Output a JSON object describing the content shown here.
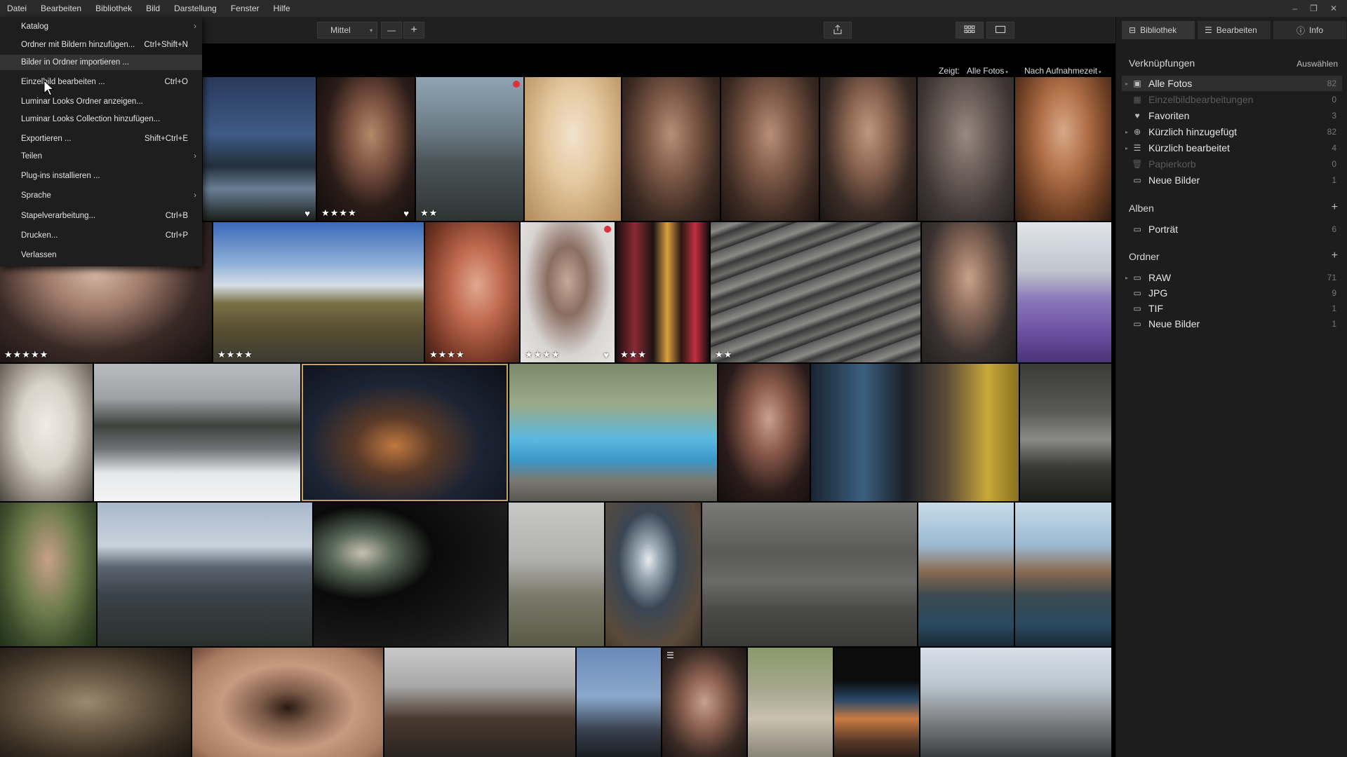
{
  "menubar": {
    "items": [
      "Datei",
      "Bearbeiten",
      "Bibliothek",
      "Bild",
      "Darstellung",
      "Fenster",
      "Hilfe"
    ],
    "window_controls": [
      "–",
      "❐",
      "✕"
    ]
  },
  "toolbar": {
    "zoom_select": "Mittel",
    "zoom_out": "—",
    "zoom_in": "+",
    "share_icon": "share-icon",
    "grid_icon": "grid-view-icon",
    "single_icon": "single-view-icon"
  },
  "filter": {
    "show_label": "Zeigt:",
    "show_value": "Alle Fotos",
    "sort_value": "Nach Aufnahmezeit"
  },
  "file_menu": {
    "items": [
      {
        "label": "Katalog",
        "shortcut": "",
        "submenu": true
      },
      {
        "label": "Ordner mit Bildern hinzufügen...",
        "shortcut": "Ctrl+Shift+N",
        "submenu": false
      },
      {
        "label": "Bilder in Ordner importieren ...",
        "shortcut": "",
        "submenu": false
      },
      {
        "label": "Einzelbild bearbeiten ...",
        "shortcut": "Ctrl+O",
        "submenu": false
      },
      {
        "label": "Luminar Looks Ordner anzeigen...",
        "shortcut": "",
        "submenu": false
      },
      {
        "label": "Luminar Looks Collection hinzufügen...",
        "shortcut": "",
        "submenu": false
      },
      {
        "label": "Exportieren ...",
        "shortcut": "Shift+Ctrl+E",
        "submenu": false
      },
      {
        "label": "Teilen",
        "shortcut": "",
        "submenu": true
      },
      {
        "label": "Plug-ins installieren ...",
        "shortcut": "",
        "submenu": false
      },
      {
        "label": "Sprache",
        "shortcut": "",
        "submenu": true
      },
      {
        "label": "Stapelverarbeitung...",
        "shortcut": "Ctrl+B",
        "submenu": false
      },
      {
        "label": "Drucken...",
        "shortcut": "Ctrl+P",
        "submenu": false
      },
      {
        "label": "Verlassen",
        "shortcut": "",
        "submenu": false
      }
    ]
  },
  "sidebar": {
    "tabs": [
      {
        "label": "Bibliothek",
        "icon": "library-icon"
      },
      {
        "label": "Bearbeiten",
        "icon": "sliders-icon"
      },
      {
        "label": "Info",
        "icon": "info-icon"
      }
    ],
    "shortcuts_title": "Verknüpfungen",
    "shortcuts_action": "Auswählen",
    "shortcuts": [
      {
        "label": "Alle Fotos",
        "count": "82"
      },
      {
        "label": "Einzelbildbearbeitungen",
        "count": "0"
      },
      {
        "label": "Favoriten",
        "count": "3"
      },
      {
        "label": "Kürzlich hinzugefügt",
        "count": "82"
      },
      {
        "label": "Kürzlich bearbeitet",
        "count": "4"
      },
      {
        "label": "Papierkorb",
        "count": "0"
      },
      {
        "label": "Neue Bilder",
        "count": "1"
      }
    ],
    "albums_title": "Alben",
    "albums_add": "+",
    "albums": [
      {
        "label": "Porträt",
        "count": "6"
      }
    ],
    "folders_title": "Ordner",
    "folders_add": "+",
    "folders": [
      {
        "label": "RAW",
        "count": "71"
      },
      {
        "label": "JPG",
        "count": "9"
      },
      {
        "label": "TIF",
        "count": "1"
      },
      {
        "label": "Neue Bilder",
        "count": "1"
      }
    ]
  },
  "photos": {
    "row1": [
      {
        "stars": "",
        "heart": "♥"
      },
      {
        "stars": "★★★★",
        "heart": "♥"
      },
      {
        "stars": "★★",
        "heart": ""
      },
      {
        "stars": "",
        "heart": ""
      },
      {
        "stars": "",
        "heart": ""
      },
      {
        "stars": "",
        "heart": ""
      },
      {
        "stars": "",
        "heart": ""
      },
      {
        "stars": "",
        "heart": ""
      },
      {
        "stars": "",
        "heart": ""
      }
    ],
    "row2": [
      {
        "stars": "★★★★★",
        "heart": ""
      },
      {
        "stars": "★★★★",
        "heart": ""
      },
      {
        "stars": "★★★★",
        "heart": ""
      },
      {
        "stars": "★★★★",
        "heart": "♥"
      },
      {
        "stars": "★★★",
        "heart": ""
      },
      {
        "stars": "★★",
        "heart": ""
      },
      {
        "stars": "",
        "heart": ""
      },
      {
        "stars": "",
        "heart": ""
      }
    ]
  }
}
